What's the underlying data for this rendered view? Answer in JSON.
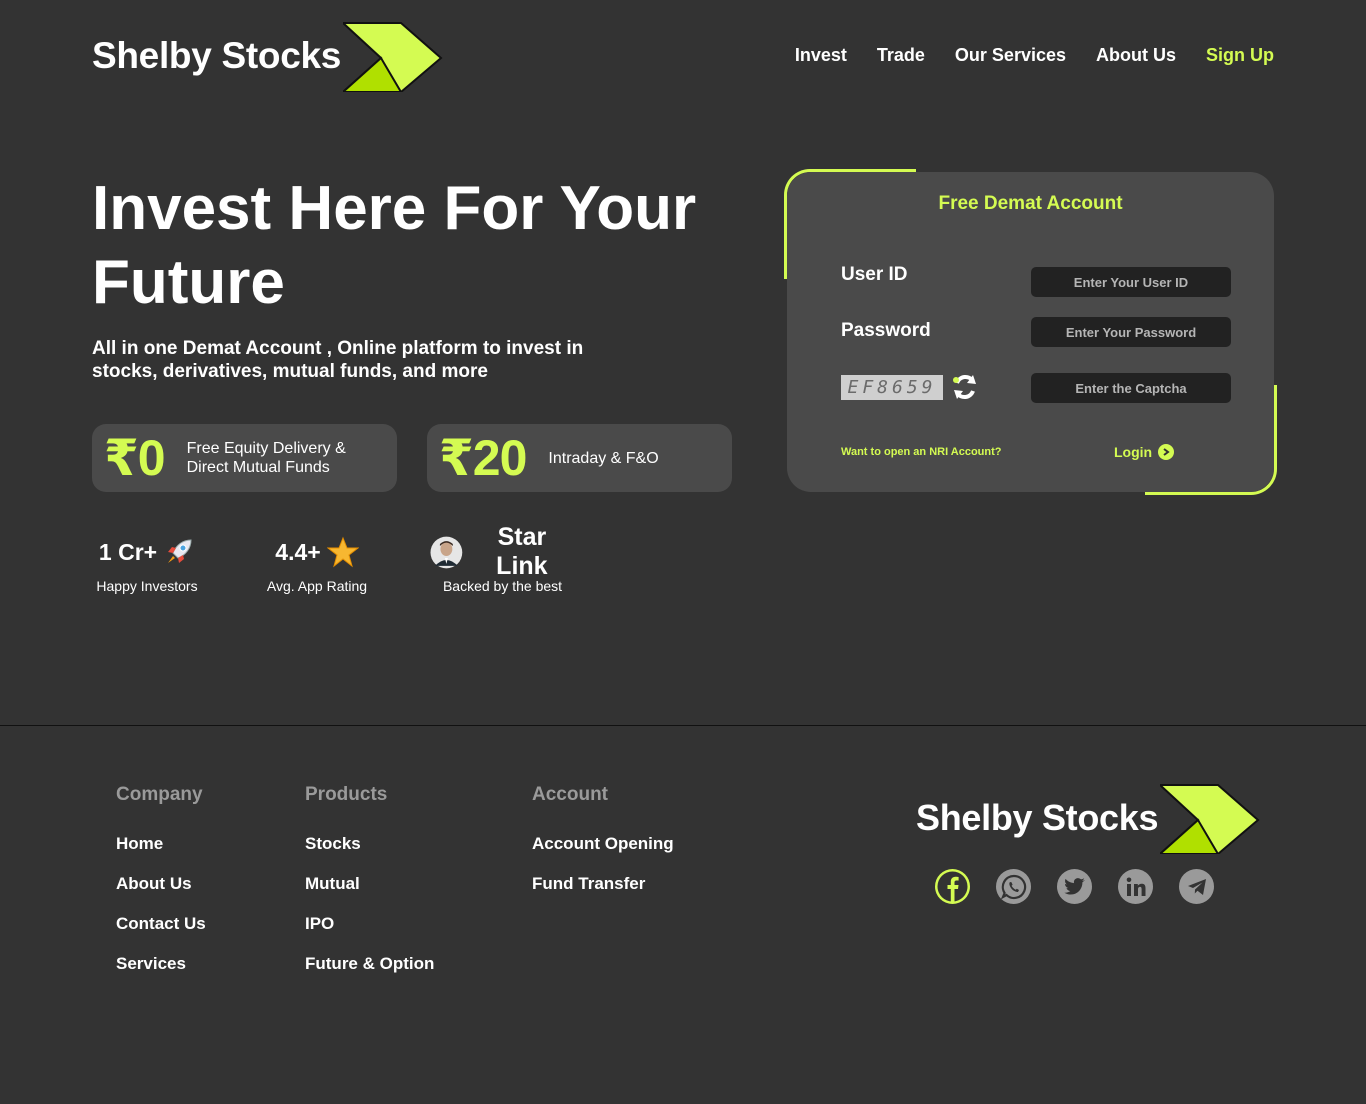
{
  "header": {
    "brand": "Shelby Stocks",
    "nav": [
      {
        "label": "Invest"
      },
      {
        "label": "Trade"
      },
      {
        "label": "Our Services"
      },
      {
        "label": "About Us"
      },
      {
        "label": "Sign Up"
      }
    ]
  },
  "hero": {
    "title": "Invest Here For Your Future",
    "subtitle": "All in one Demat Account , Online platform to invest in stocks, derivatives, mutual funds, and more",
    "pills": [
      {
        "value": "₹0",
        "text": "Free Equity Delivery & Direct Mutual Funds"
      },
      {
        "value": "₹20",
        "text": "Intraday & F&O"
      }
    ],
    "stats": [
      {
        "value": "1 Cr+",
        "label": "Happy Investors",
        "icon": "rocket-icon"
      },
      {
        "value": "4.4+",
        "label": "Avg. App Rating",
        "icon": "star-icon"
      },
      {
        "value": "Star Link",
        "label": "Backed by the best",
        "icon": "avatar"
      }
    ]
  },
  "login_card": {
    "title": "Free Demat Account",
    "user_id_label": "User ID",
    "user_id_placeholder": "Enter Your User ID",
    "password_label": "Password",
    "password_placeholder": "Enter Your Password",
    "captcha_text": "EF8659",
    "captcha_placeholder": "Enter the Captcha",
    "nri_link": "Want to open an NRI Account?",
    "login_label": "Login"
  },
  "footer": {
    "columns": [
      {
        "heading": "Company",
        "links": [
          "Home",
          "About Us",
          "Contact Us",
          "Services"
        ]
      },
      {
        "heading": "Products",
        "links": [
          "Stocks",
          "Mutual",
          "IPO",
          "Future & Option"
        ]
      },
      {
        "heading": "Account",
        "links": [
          "Account Opening",
          "Fund Transfer"
        ]
      }
    ],
    "brand": "Shelby Stocks",
    "socials": [
      "facebook-icon",
      "whatsapp-icon",
      "twitter-icon",
      "linkedin-icon",
      "telegram-icon"
    ]
  },
  "colors": {
    "background": "#333333",
    "card": "#4a4a4a",
    "accent": "#d4fb52",
    "accent_dark": "#b0e000",
    "muted": "#9a9a9a"
  }
}
